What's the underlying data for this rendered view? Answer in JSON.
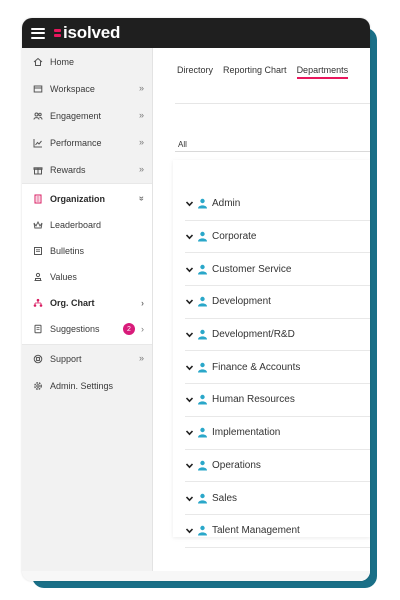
{
  "app": {
    "logo_text": "isolved",
    "accent_color": "#e8175d",
    "brand_teal": "#1a6f87"
  },
  "sidebar": {
    "items": [
      {
        "label": "Home",
        "icon": "home-icon",
        "chevron": ""
      },
      {
        "label": "Workspace",
        "icon": "workspace-icon",
        "chevron": "»"
      },
      {
        "label": "Engagement",
        "icon": "people-icon",
        "chevron": "»"
      },
      {
        "label": "Performance",
        "icon": "chart-icon",
        "chevron": "»"
      },
      {
        "label": "Rewards",
        "icon": "gift-icon",
        "chevron": "»"
      }
    ],
    "organization": {
      "label": "Organization",
      "icon": "building-icon",
      "chevron": "»",
      "children": [
        {
          "label": "Leaderboard",
          "icon": "crown-icon",
          "chevron": ""
        },
        {
          "label": "Bulletins",
          "icon": "bulletin-icon",
          "chevron": ""
        },
        {
          "label": "Values",
          "icon": "values-icon",
          "chevron": ""
        },
        {
          "label": "Org. Chart",
          "icon": "org-chart-icon",
          "chevron": "›"
        },
        {
          "label": "Suggestions",
          "icon": "suggestions-icon",
          "chevron": "›",
          "badge": "2"
        }
      ]
    },
    "footer_items": [
      {
        "label": "Support",
        "icon": "support-icon",
        "chevron": "»"
      },
      {
        "label": "Admin. Settings",
        "icon": "settings-icon",
        "chevron": ""
      }
    ]
  },
  "main": {
    "tabs": [
      {
        "label": "Directory",
        "active": false
      },
      {
        "label": "Reporting Chart",
        "active": false
      },
      {
        "label": "Departments",
        "active": true
      }
    ],
    "filter_value": "All",
    "departments": [
      "Admin",
      "Corporate",
      "Customer Service",
      "Development",
      "Development/R&D",
      "Finance & Accounts",
      "Human Resources",
      "Implementation",
      "Operations",
      "Sales",
      "Talent Management"
    ]
  }
}
